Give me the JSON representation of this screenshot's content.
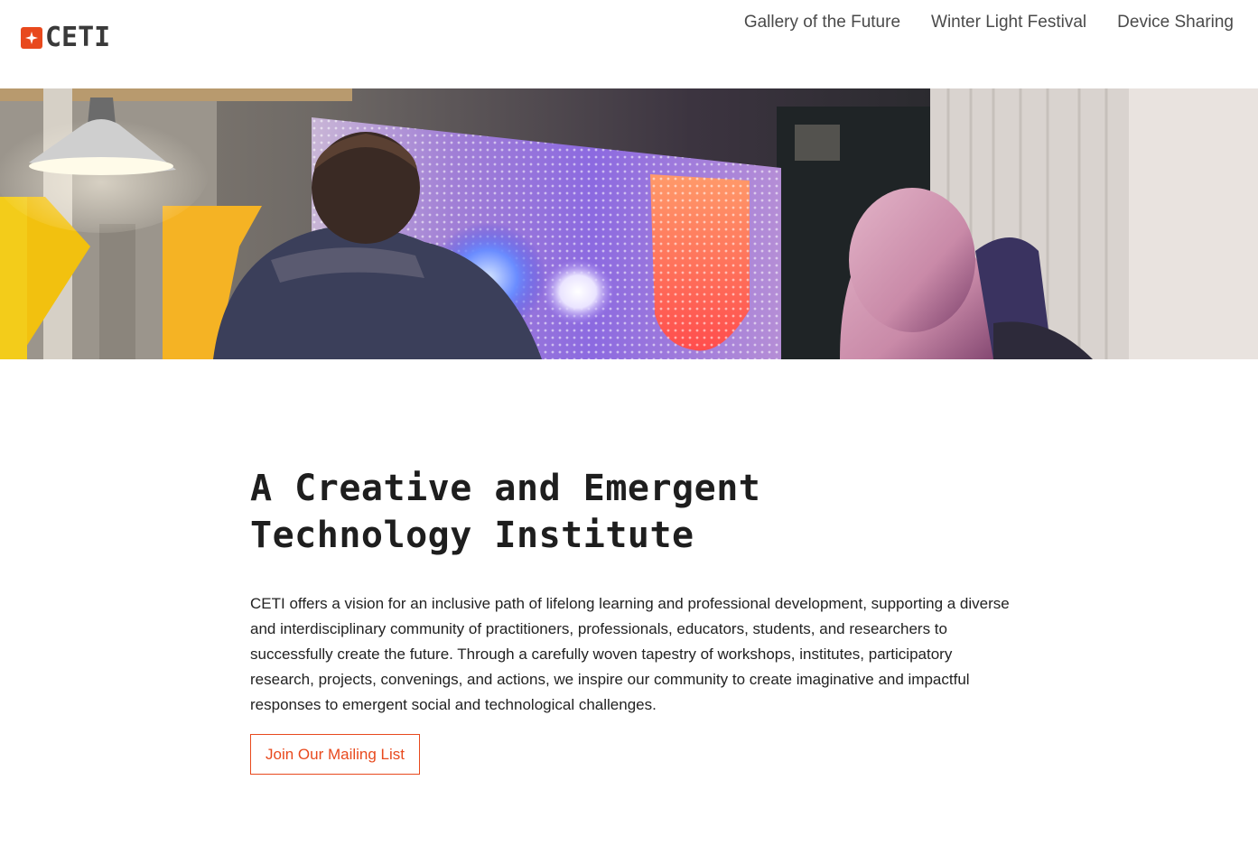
{
  "header": {
    "logo_text": "CETI",
    "nav": [
      {
        "label": "Gallery of the Future"
      },
      {
        "label": "Winter Light Festival"
      },
      {
        "label": "Device Sharing"
      }
    ]
  },
  "colors": {
    "brand": "#e8491d",
    "text": "#222222",
    "nav_text": "#4a4a4a"
  },
  "main": {
    "title_line1": "A Creative and Emergent",
    "title_line2": "Technology Institute",
    "description": "CETI offers a vision for an inclusive path of lifelong learning and professional development, supporting a diverse and interdisciplinary community of practitioners, professionals, educators, students, and researchers to successfully create the future. Through a carefully woven tapestry of workshops, institutes, participatory research, projects, convenings, and actions, we inspire our community to create imaginative and impactful responses to emergent social and technological challenges.",
    "cta_label": "Join Our Mailing List"
  }
}
